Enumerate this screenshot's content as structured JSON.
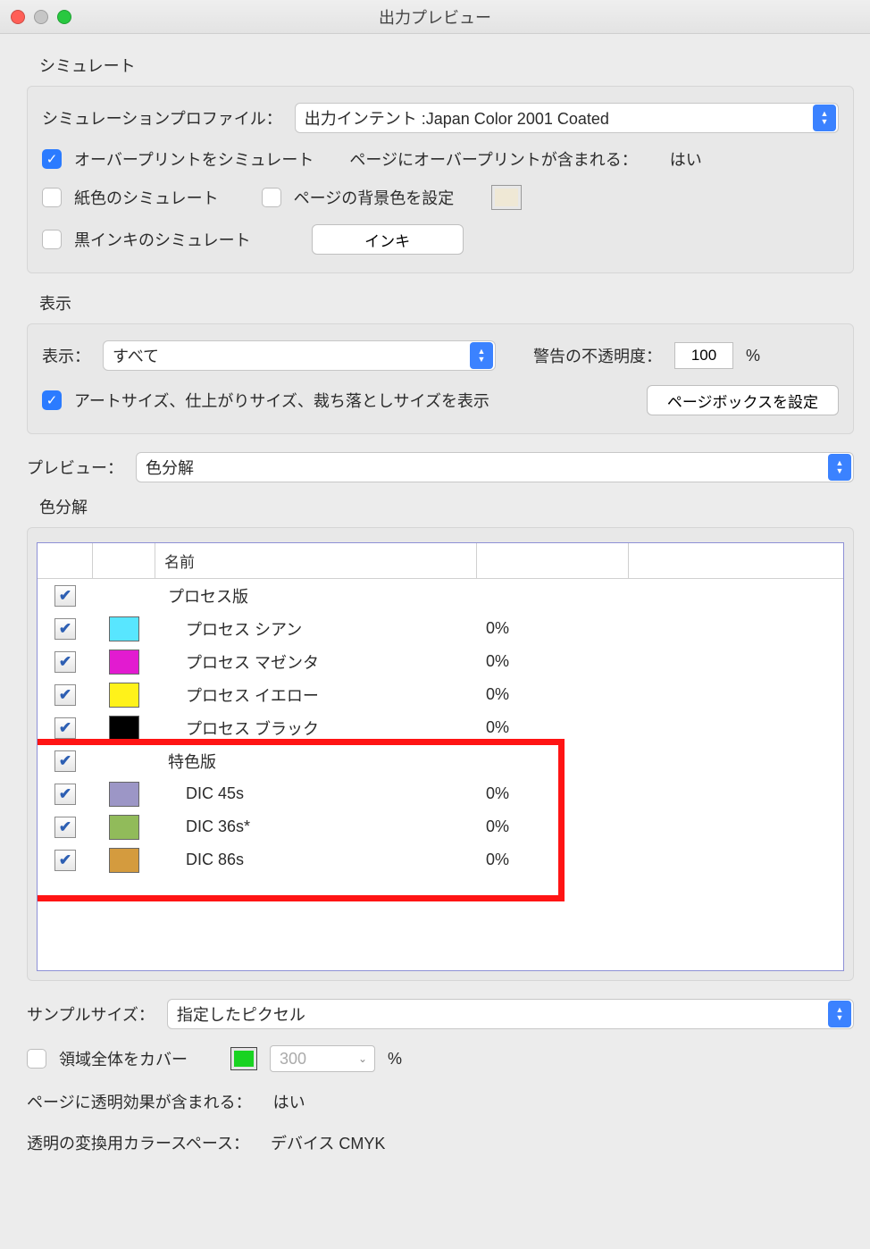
{
  "window": {
    "title": "出力プレビュー"
  },
  "simulate": {
    "heading": "シミュレート",
    "profile_label": "シミュレーションプロファイル：",
    "profile_value": "出力インテント :Japan Color 2001 Coated",
    "overprint_label": "オーバープリントをシミュレート",
    "overprint_checked": true,
    "overprint_contains_label": "ページにオーバープリントが含まれる：",
    "overprint_contains_value": "はい",
    "paper_label": "紙色のシミュレート",
    "paper_checked": false,
    "bg_label": "ページの背景色を設定",
    "bg_checked": false,
    "bg_swatch": "#efe8d5",
    "blackink_label": "黒インキのシミュレート",
    "blackink_checked": false,
    "ink_button": "インキ"
  },
  "display": {
    "heading": "表示",
    "show_label": "表示：",
    "show_value": "すべて",
    "opacity_label": "警告の不透明度：",
    "opacity_value": "100",
    "opacity_unit": "%",
    "artsize_label": "アートサイズ、仕上がりサイズ、裁ち落としサイズを表示",
    "artsize_checked": true,
    "pagebox_button": "ページボックスを設定"
  },
  "preview": {
    "label": "プレビュー：",
    "value": "色分解"
  },
  "separations": {
    "heading": "色分解",
    "header_name": "名前",
    "rows": [
      {
        "checked": true,
        "color": null,
        "name": "プロセス版",
        "pct": "",
        "group": true
      },
      {
        "checked": true,
        "color": "#58e6ff",
        "name": "プロセス シアン",
        "pct": "0%",
        "group": false
      },
      {
        "checked": true,
        "color": "#e21bd0",
        "name": "プロセス マゼンタ",
        "pct": "0%",
        "group": false
      },
      {
        "checked": true,
        "color": "#fff21a",
        "name": "プロセス イエロー",
        "pct": "0%",
        "group": false
      },
      {
        "checked": true,
        "color": "#000000",
        "name": "プロセス ブラック",
        "pct": "0%",
        "group": false
      },
      {
        "checked": true,
        "color": null,
        "name": "特色版",
        "pct": "",
        "group": true
      },
      {
        "checked": true,
        "color": "#9c96c6",
        "name": "DIC 45s",
        "pct": "0%",
        "group": false
      },
      {
        "checked": true,
        "color": "#91bb5a",
        "name": "DIC 36s*",
        "pct": "0%",
        "group": false
      },
      {
        "checked": true,
        "color": "#d49b3e",
        "name": "DIC 86s",
        "pct": "0%",
        "group": false
      }
    ],
    "highlight": {
      "from": 5,
      "to": 8
    }
  },
  "sample": {
    "label": "サンプルサイズ：",
    "value": "指定したピクセル"
  },
  "cover": {
    "label": "領域全体をカバー",
    "checked": false,
    "swatch": "#19d321",
    "value": "300",
    "unit": "%"
  },
  "info": {
    "transp_label": "ページに透明効果が含まれる：",
    "transp_value": "はい",
    "space_label": "透明の変換用カラースペース：",
    "space_value": "デバイス CMYK"
  }
}
